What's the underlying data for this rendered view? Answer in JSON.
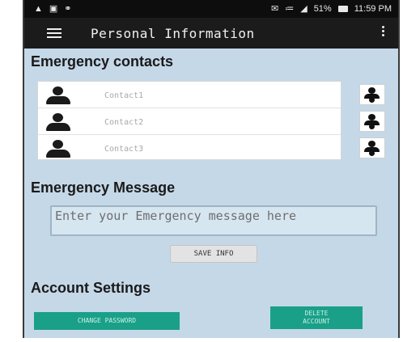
{
  "status_bar": {
    "icons_left": [
      "navigation-icon",
      "image-icon",
      "headset-icon"
    ],
    "icons_right": [
      "notifications-icon",
      "wifi-icon",
      "signal-icon",
      "battery-icon"
    ],
    "battery": "51%",
    "time": "11:59 PM"
  },
  "app_bar": {
    "title": "Personal Information"
  },
  "emergency_contacts": {
    "title": "Emergency contacts",
    "contacts": [
      {
        "placeholder": "Contact1",
        "value": ""
      },
      {
        "placeholder": "Contact2",
        "value": ""
      },
      {
        "placeholder": "Contact3",
        "value": ""
      }
    ]
  },
  "emergency_message": {
    "title": "Emergency Message",
    "placeholder": "Enter your Emergency message here",
    "value": ""
  },
  "save_info_label": "SAVE INFO",
  "account_settings": {
    "title": "Account Settings",
    "change_password_label": "CHANGE PASSWORD",
    "delete_account_line1": "DELETE",
    "delete_account_line2": "ACCOUNT"
  },
  "colors": {
    "background": "#c5d8e8",
    "app_bar": "#1b1b1b",
    "accent_button": "#1aa088"
  }
}
